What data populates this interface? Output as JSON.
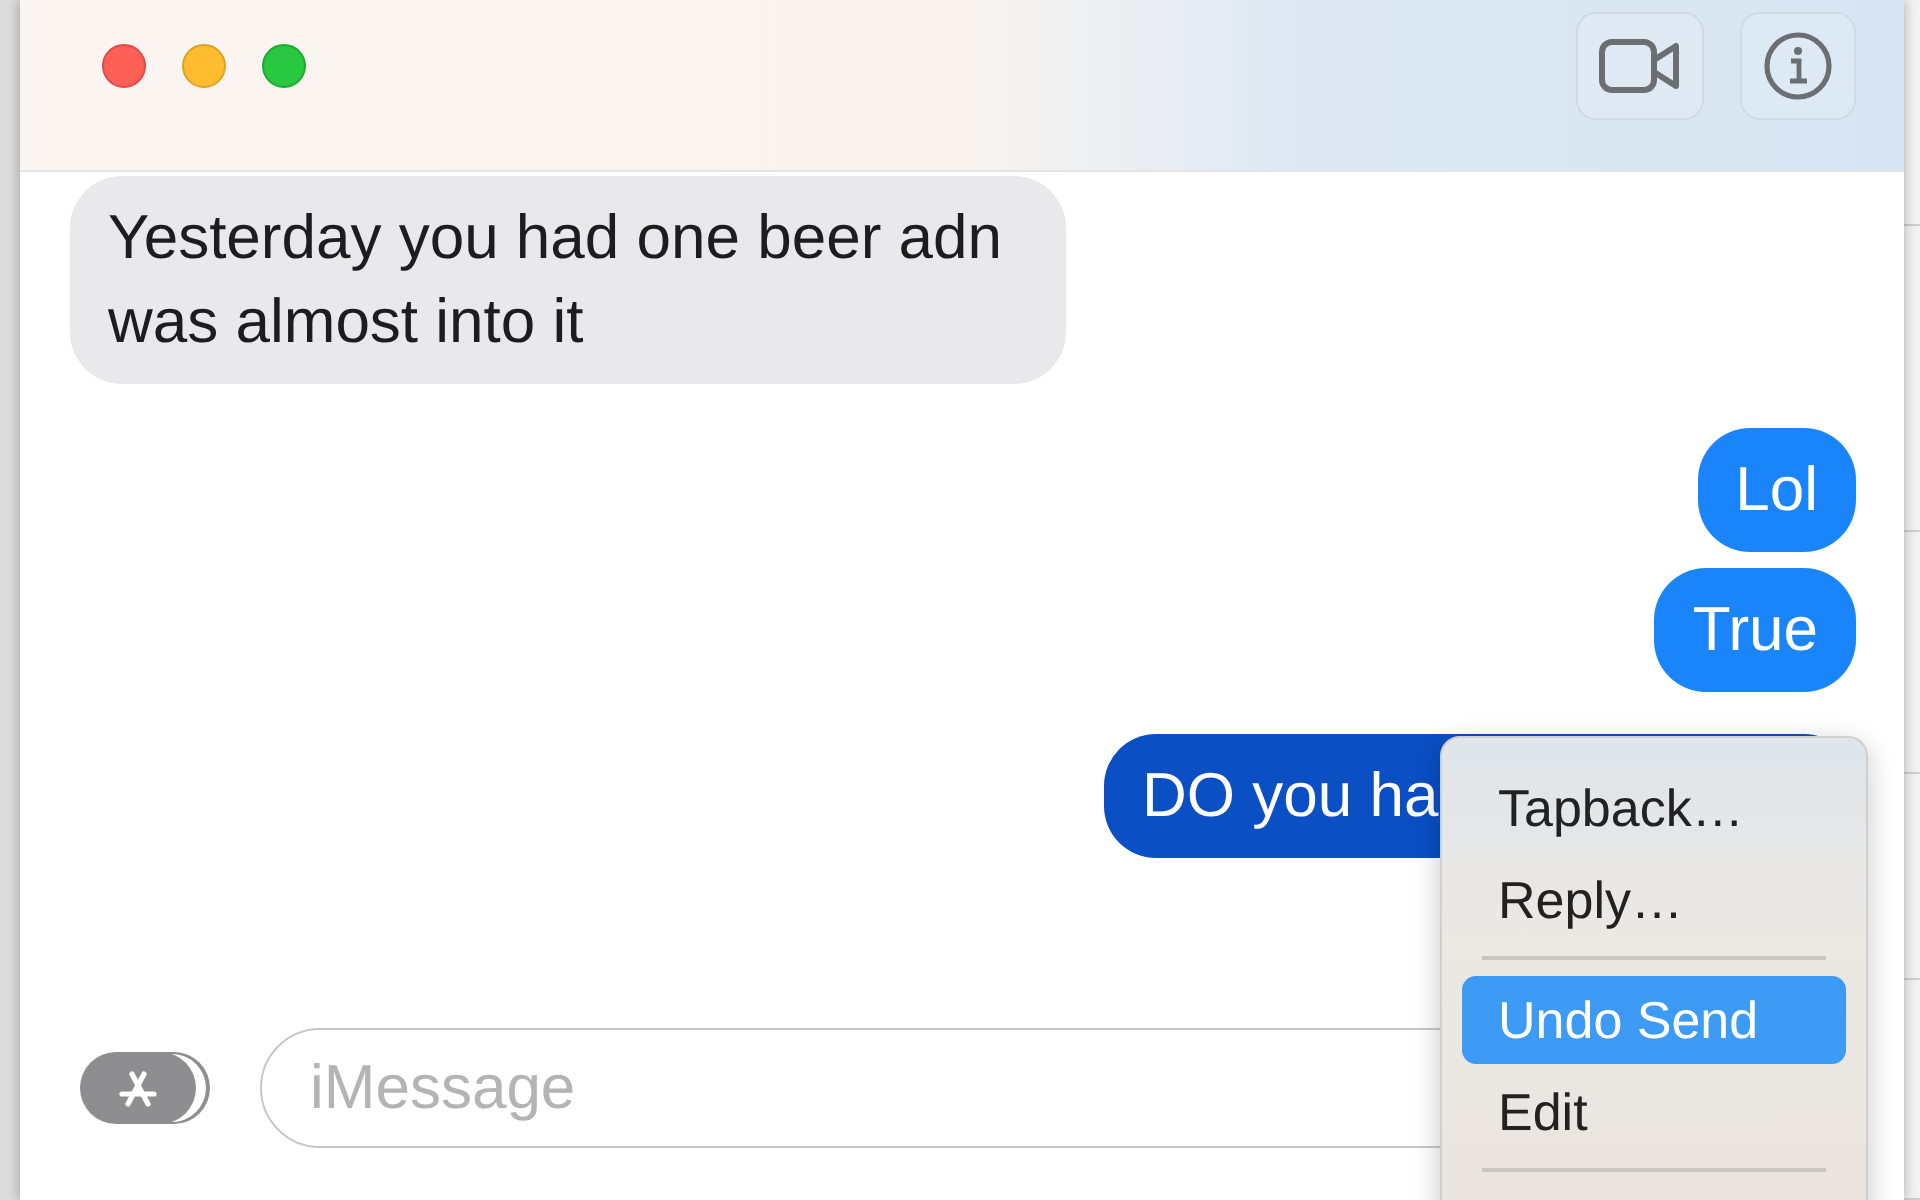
{
  "messages": [
    {
      "kind": "received",
      "text": "Yesterday you had one beer adn was almost into it",
      "selected": false
    },
    {
      "kind": "sent",
      "text": "Lol",
      "selected": false
    },
    {
      "kind": "sent",
      "text": "True",
      "selected": false
    },
    {
      "kind": "sent",
      "text": "DO you ha",
      "selected": true
    }
  ],
  "composer": {
    "placeholder": "iMessage"
  },
  "context_menu": {
    "items": [
      {
        "kind": "item",
        "label": "Tapback…",
        "selected": false
      },
      {
        "kind": "item",
        "label": "Reply…",
        "selected": false
      },
      {
        "kind": "divider"
      },
      {
        "kind": "item",
        "label": "Undo Send",
        "selected": true
      },
      {
        "kind": "item",
        "label": "Edit",
        "selected": false
      },
      {
        "kind": "divider"
      }
    ]
  }
}
